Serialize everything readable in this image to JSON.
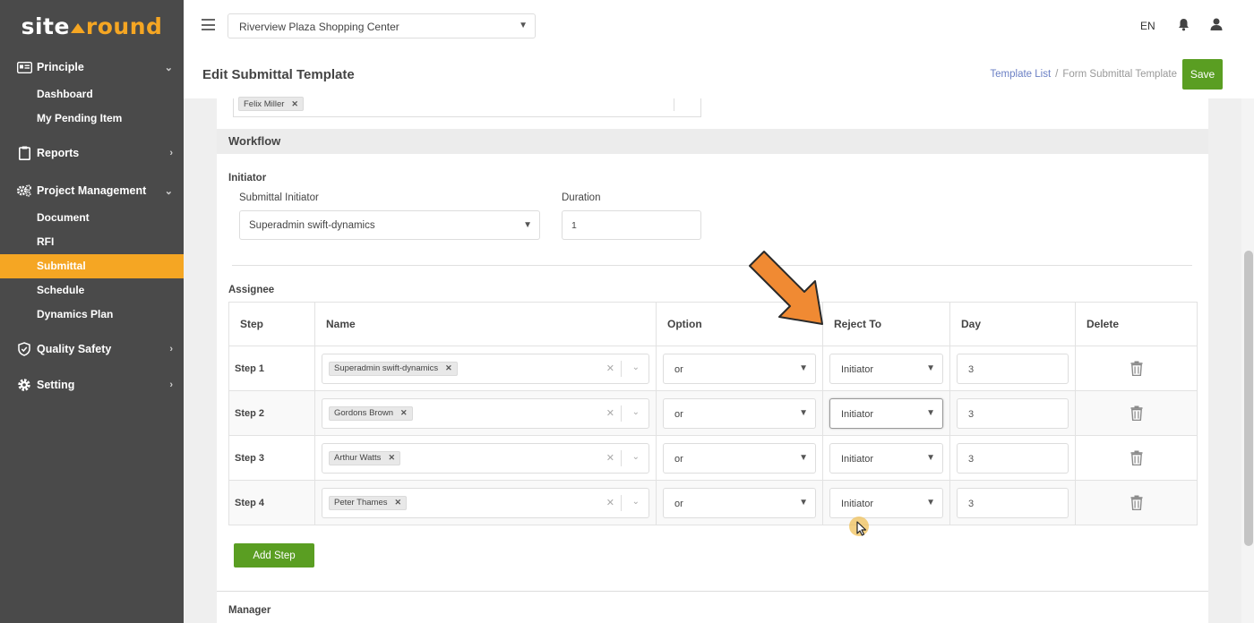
{
  "brand": {
    "left": "site",
    "right": "round"
  },
  "sidebar": {
    "principle": {
      "label": "Principle",
      "items": [
        "Dashboard",
        "My Pending Item"
      ]
    },
    "reports": {
      "label": "Reports"
    },
    "project_management": {
      "label": "Project Management",
      "items": [
        "Document",
        "RFI",
        "Submittal",
        "Schedule",
        "Dynamics Plan"
      ],
      "active": "Submittal"
    },
    "quality_safety": {
      "label": "Quality Safety"
    },
    "setting": {
      "label": "Setting"
    }
  },
  "topbar": {
    "project": "Riverview Plaza Shopping Center",
    "language": "EN"
  },
  "header": {
    "title": "Edit Submittal Template",
    "breadcrumb": {
      "link": "Template List",
      "separator": "/",
      "current": "Form Submittal Template"
    },
    "save_label": "Save"
  },
  "previous_field": {
    "chip": "Felix Miller"
  },
  "workflow": {
    "title": "Workflow",
    "initiator_label": "Initiator",
    "submittal_initiator_label": "Submittal Initiator",
    "submittal_initiator_value": "Superadmin swift-dynamics",
    "duration_label": "Duration",
    "duration_value": "1"
  },
  "assignee": {
    "label": "Assignee",
    "columns": {
      "step": "Step",
      "name": "Name",
      "option": "Option",
      "reject_to": "Reject To",
      "day": "Day",
      "delete": "Delete"
    },
    "rows": [
      {
        "step": "Step 1",
        "name": "Superadmin swift-dynamics",
        "option": "or",
        "reject_to": "Initiator",
        "day": "3"
      },
      {
        "step": "Step 2",
        "name": "Gordons Brown",
        "option": "or",
        "reject_to": "Initiator",
        "day": "3"
      },
      {
        "step": "Step 3",
        "name": "Arthur Watts",
        "option": "or",
        "reject_to": "Initiator",
        "day": "3"
      },
      {
        "step": "Step 4",
        "name": "Peter Thames",
        "option": "or",
        "reject_to": "Initiator",
        "day": "3"
      }
    ],
    "add_step_label": "Add Step"
  },
  "manager": {
    "title": "Manager"
  },
  "colors": {
    "sidebar": "#4a4a4a",
    "active": "#f5a623",
    "primary_button": "#5a9e22",
    "link": "#6a7fc4",
    "annotation_arrow": "#f08a33"
  }
}
